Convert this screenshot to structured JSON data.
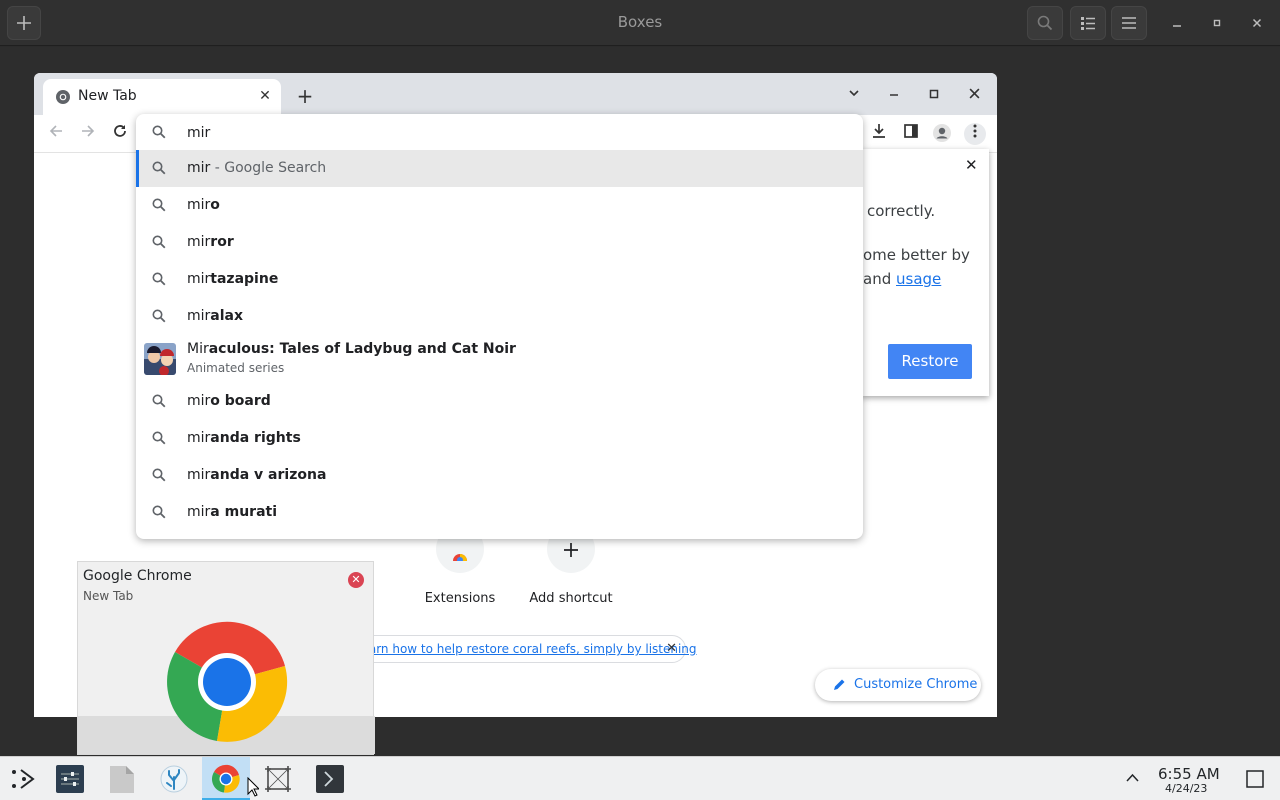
{
  "boxes": {
    "title": "Boxes"
  },
  "chrome": {
    "tab_title": "New Tab",
    "omnibox_text": "mir",
    "suggestions": [
      {
        "typed": "mir",
        "rest": "",
        "suffix": " - Google Search",
        "icon": "search-icon"
      },
      {
        "typed": "mir",
        "rest": "o",
        "suffix": "",
        "icon": "search-icon"
      },
      {
        "typed": "mir",
        "rest": "ror",
        "suffix": "",
        "icon": "search-icon"
      },
      {
        "typed": "mir",
        "rest": "tazapine",
        "suffix": "",
        "icon": "search-icon"
      },
      {
        "typed": "mir",
        "rest": "alax",
        "suffix": "",
        "icon": "search-icon"
      },
      {
        "typed": "mir",
        "rest": "o board",
        "suffix": "",
        "icon": "search-icon"
      },
      {
        "typed": "mir",
        "rest": "anda rights",
        "suffix": "",
        "icon": "search-icon"
      },
      {
        "typed": "mir",
        "rest": "anda v arizona",
        "suffix": "",
        "icon": "search-icon"
      },
      {
        "typed": "mir",
        "rest": "a murati",
        "suffix": "",
        "icon": "search-icon"
      }
    ],
    "entity": {
      "typed": "Mir",
      "rest": "aculous: Tales of Ladybug and Cat Noir",
      "subtitle": "Animated series"
    },
    "restore_popup": {
      "line1": "correctly.",
      "line2": "ome better by",
      "line3_prefix": "and ",
      "line3_link": "usage",
      "button": "Restore"
    },
    "shortcuts": [
      {
        "label": "Extensions"
      },
      {
        "label": "Add shortcut"
      }
    ],
    "promo_link": "Learn how to help restore coral reefs, simply by listening",
    "customize_label": "Customize Chrome"
  },
  "preview": {
    "app_name": "Google Chrome",
    "window_title": "New Tab"
  },
  "taskbar": {
    "time": "6:55 AM",
    "date": "4/24/23"
  },
  "colors": {
    "accent": "#1a73e8",
    "restore_button": "#4285f4",
    "taskbar_active": "#3daee9"
  }
}
